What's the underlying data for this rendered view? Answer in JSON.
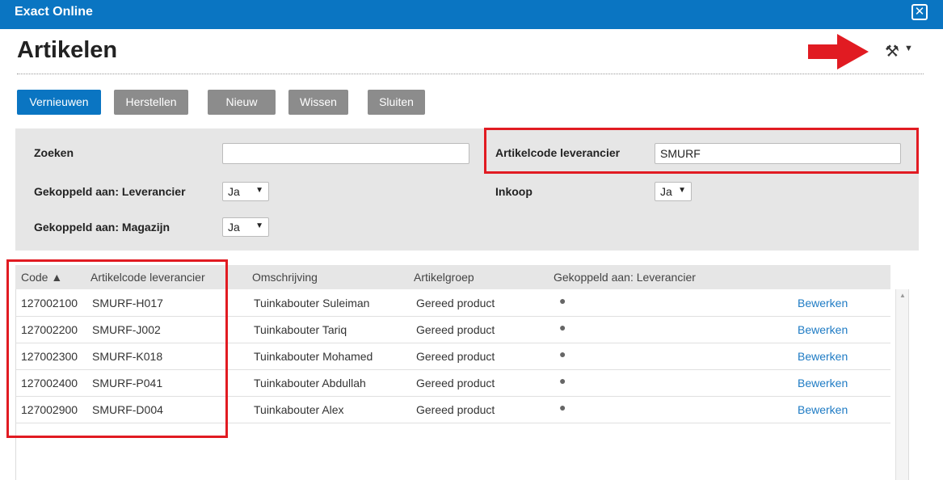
{
  "window": {
    "app_title": "Exact Online",
    "close_glyph": "✕"
  },
  "page": {
    "title": "Artikelen"
  },
  "toolbar": {
    "buttons": [
      "Vernieuwen",
      "Herstellen",
      "Nieuw",
      "Wissen",
      "Sluiten"
    ]
  },
  "filters": {
    "zoeken_label": "Zoeken",
    "zoeken_value": "",
    "artikelcode_label": "Artikelcode leverancier",
    "artikelcode_value": "SMURF",
    "leverancier_label": "Gekoppeld aan: Leverancier",
    "leverancier_value": "Ja",
    "inkoop_label": "Inkoop",
    "inkoop_value": "Ja",
    "magazijn_label": "Gekoppeld aan: Magazijn",
    "magazijn_value": "Ja"
  },
  "grid": {
    "columns": [
      "Code ▲",
      "Artikelcode leverancier",
      "Omschrijving",
      "Artikelgroep",
      "Gekoppeld aan: Leverancier"
    ],
    "rows": [
      {
        "code": "127002100",
        "supplier_code": "SMURF-H017",
        "description": "Tuinkabouter Suleiman",
        "group": "Gereed product",
        "linked": "●",
        "action": "Bewerken"
      },
      {
        "code": "127002200",
        "supplier_code": "SMURF-J002",
        "description": "Tuinkabouter Tariq",
        "group": "Gereed product",
        "linked": "●",
        "action": "Bewerken"
      },
      {
        "code": "127002300",
        "supplier_code": "SMURF-K018",
        "description": "Tuinkabouter Mohamed",
        "group": "Gereed product",
        "linked": "●",
        "action": "Bewerken"
      },
      {
        "code": "127002400",
        "supplier_code": "SMURF-P041",
        "description": "Tuinkabouter Abdullah",
        "group": "Gereed product",
        "linked": "●",
        "action": "Bewerken"
      },
      {
        "code": "127002900",
        "supplier_code": "SMURF-D004",
        "description": "Tuinkabouter Alex",
        "group": "Gereed product",
        "linked": "●",
        "action": "Bewerken"
      }
    ]
  },
  "icons": {
    "settings": "wrench-screwdriver-icon",
    "annotation_arrow": "red-arrow-icon",
    "annotation_color": "#e11b22",
    "brand_color": "#0a75c2"
  }
}
